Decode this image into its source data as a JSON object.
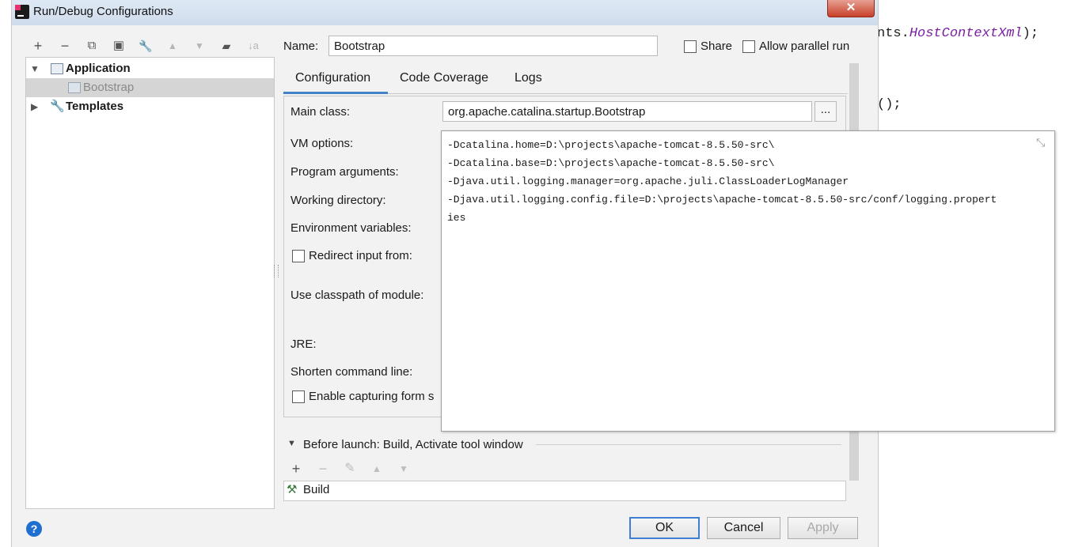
{
  "window": {
    "title": "Run/Debug Configurations",
    "close_glyph": "✕"
  },
  "toolbar": {
    "add": "+",
    "remove": "−",
    "copy": "⧉",
    "save": "▣",
    "edit_defaults": "🔧",
    "move_up": "▲",
    "move_down": "▼",
    "new_folder": "▰",
    "sort": "↓a"
  },
  "tree": {
    "items": [
      {
        "label": "Application",
        "expanded": true
      },
      {
        "label": "Bootstrap",
        "selected": true
      },
      {
        "label": "Templates",
        "expanded": false
      }
    ]
  },
  "name_field": {
    "label": "Name:",
    "value": "Bootstrap"
  },
  "share": {
    "label": "Share",
    "checked": false
  },
  "parallel": {
    "label": "Allow parallel run",
    "checked": false
  },
  "tabs": [
    {
      "label": "Configuration",
      "active": true
    },
    {
      "label": "Code Coverage"
    },
    {
      "label": "Logs"
    }
  ],
  "form": {
    "main_class_label": "Main class:",
    "main_class_value": "org.apache.catalina.startup.Bootstrap",
    "browse_label": "...",
    "vm_options_label": "VM options:",
    "program_args_label": "Program arguments:",
    "working_dir_label": "Working directory:",
    "env_vars_label": "Environment variables:",
    "redirect_label": "Redirect input from:",
    "classpath_label": "Use classpath of module:",
    "jre_label": "JRE:",
    "shorten_label": "Shorten command line:",
    "capturing_label": "Enable capturing form s"
  },
  "vm_popup": {
    "lines": [
      "-Dcatalina.home=D:\\projects\\apache-tomcat-8.5.50-src\\",
      "-Dcatalina.base=D:\\projects\\apache-tomcat-8.5.50-src\\",
      "-Djava.util.logging.manager=org.apache.juli.ClassLoaderLogManager",
      "-Djava.util.logging.config.file=D:\\projects\\apache-tomcat-8.5.50-src/conf/logging.propert",
      "ies"
    ],
    "collapse_glyph": "⤡"
  },
  "before_launch": {
    "title": "Before launch: Build, Activate tool window",
    "add": "+",
    "remove": "−",
    "edit": "✎",
    "up": "▲",
    "down": "▼",
    "tasks": [
      {
        "label": "Build"
      }
    ]
  },
  "buttons": {
    "ok": "OK",
    "cancel": "Cancel",
    "apply": "Apply",
    "help": "?"
  },
  "editor_bg": {
    "line1_prefix": "nts.",
    "line1_symbol": "HostContextXml",
    "line1_suffix": ");",
    "line2": "();"
  }
}
